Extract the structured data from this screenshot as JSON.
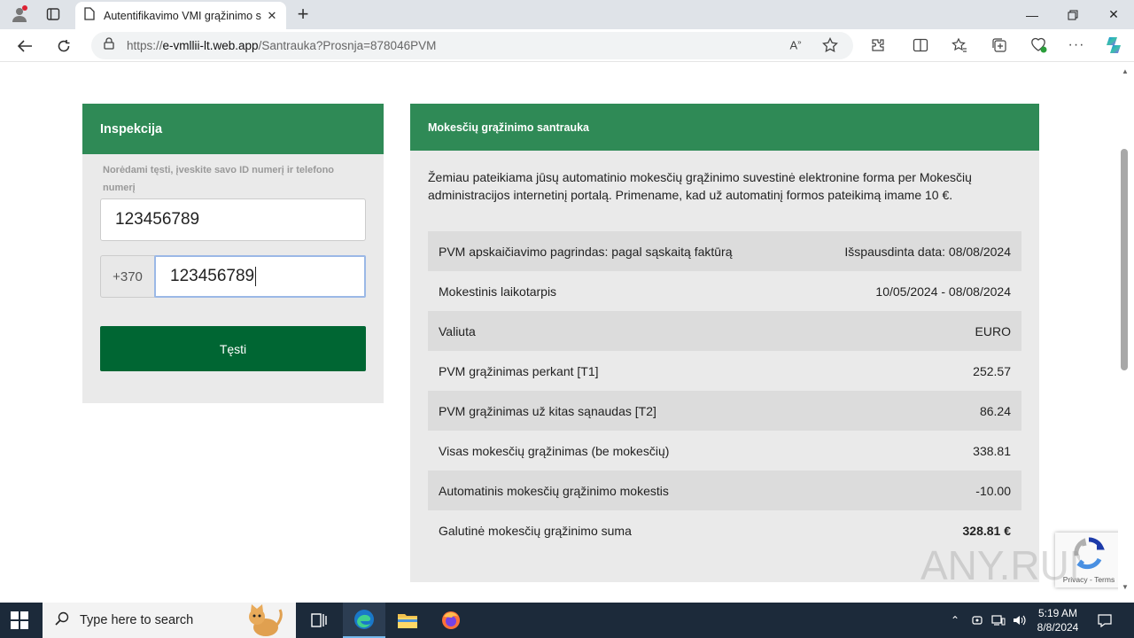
{
  "browser": {
    "tab_title": "Autentifikavimo VMI grąžinimo s",
    "url_prefix": "https://",
    "url_host": "e-vmllii-lt.web.app",
    "url_path": "/Santrauka?Prosnja=878046PVM"
  },
  "left_panel": {
    "title": "Inspekcija",
    "hint": "Norėdami tęsti, įveskite savo ID numerį ir telefono numerį",
    "id_value": "123456789",
    "phone_prefix": "+370",
    "phone_value": "123456789",
    "submit_label": "Tęsti"
  },
  "summary": {
    "title": "Mokesčių grąžinimo santrauka",
    "intro": "Žemiau pateikiama jūsų automatinio mokesčių grąžinimo suvestinė elektronine forma per Mokesčių administracijos internetinį portalą. Primename, kad už automatinį formos pateikimą imame 10 €.",
    "rows": [
      {
        "label": "PVM apskaičiavimo pagrindas: pagal sąskaitą faktūrą",
        "value": "Išspausdinta data: 08/08/2024"
      },
      {
        "label": "Mokestinis laikotarpis",
        "value": "10/05/2024 - 08/08/2024"
      },
      {
        "label": "Valiuta",
        "value": "EURO"
      },
      {
        "label": "PVM grąžinimas perkant [T1]",
        "value": "252.57"
      },
      {
        "label": "PVM grąžinimas už kitas sąnaudas [T2]",
        "value": "86.24"
      },
      {
        "label": "Visas mokesčių grąžinimas (be mokesčių)",
        "value": "338.81"
      },
      {
        "label": "Automatinis mokesčių grąžinimo mokestis",
        "value": "-10.00"
      },
      {
        "label": "Galutinė mokesčių grąžinimo suma",
        "value": "328.81 €"
      }
    ]
  },
  "recaptcha": {
    "links": "Privacy - Terms"
  },
  "watermark": "ANY.RUN",
  "taskbar": {
    "search_placeholder": "Type here to search",
    "time": "5:19 AM",
    "date": "8/8/2024"
  },
  "colors": {
    "header_green": "#2f8a56",
    "button_green": "#006633",
    "panel_gray": "#eaeaea"
  }
}
